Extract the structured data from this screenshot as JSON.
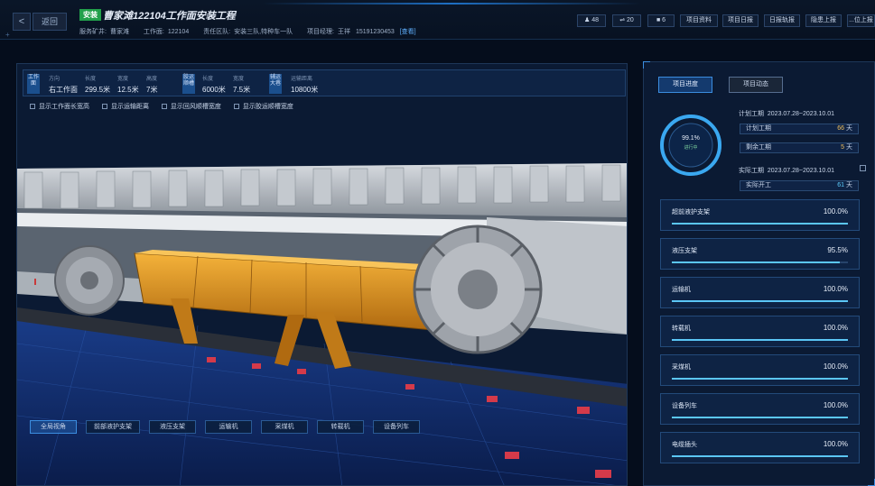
{
  "header": {
    "back_label": "返回",
    "tag": "安装",
    "title": "曹家滩122104工作面安装工程",
    "info": {
      "mine_label": "服务矿井:",
      "mine": "曹家滩",
      "face_label": "工作面:",
      "face": "122104",
      "team_label": "责任区队:",
      "team": "安装三队,特种车一队",
      "manager_label": "项目经理:",
      "manager": "王祥",
      "phone": "15191230453",
      "view_link": "[查看]"
    },
    "stats": [
      "48",
      "20",
      "6"
    ],
    "buttons": [
      "项目资料",
      "项目日报",
      "日报轨报",
      "隐患上报",
      "...位上报"
    ]
  },
  "params": {
    "group1_label": "工作面",
    "direction_label": "方向",
    "direction": "右工作面",
    "length_label": "长度",
    "length": "299.5米",
    "width_label": "宽度",
    "width": "12.5米",
    "height_label": "高度",
    "height": "7米",
    "group2_label": "胶运顺槽",
    "g2_length_label": "长度",
    "g2_length": "6000米",
    "g2_width_label": "宽度",
    "g2_width": "7.5米",
    "group3_label": "辅运大巷",
    "dist_label": "运输距离",
    "dist": "10800米"
  },
  "checks": [
    "显示工作面长宽高",
    "显示运输距离",
    "显示回风顺槽宽度",
    "显示胶运顺槽宽度"
  ],
  "view_buttons": [
    "全局视角",
    "前部液护支架",
    "液压支架",
    "运输机",
    "采煤机",
    "转载机",
    "设备列车"
  ],
  "right": {
    "tabs": [
      "项目进度",
      "项目动态"
    ],
    "progress_pct": "99.1%",
    "progress_sub": "进行中",
    "progress_value": 0.991,
    "plan_label": "计划工期",
    "plan_range": "2023.07.28~2023.10.01",
    "plan_days_label": "计划工期",
    "plan_days": "66",
    "plan_unit": "天",
    "remain_label": "剩余工期",
    "remain_days": "5",
    "remain_unit": "天",
    "actual_label": "实际工期",
    "actual_range": "2023.07.28~2023.10.01",
    "actual_start_label": "实际开工",
    "actual_start": "61",
    "actual_unit": "天",
    "equipment": [
      {
        "name": "超前液护支架",
        "value": "100.0%",
        "fraction": 1.0
      },
      {
        "name": "液压支架",
        "value": "95.5%",
        "fraction": 0.955
      },
      {
        "name": "运输机",
        "value": "100.0%",
        "fraction": 1.0
      },
      {
        "name": "转载机",
        "value": "100.0%",
        "fraction": 1.0
      },
      {
        "name": "采煤机",
        "value": "100.0%",
        "fraction": 1.0
      },
      {
        "name": "设备列车",
        "value": "100.0%",
        "fraction": 1.0
      },
      {
        "name": "电缆插头",
        "value": "100.0%",
        "fraction": 1.0
      }
    ]
  }
}
